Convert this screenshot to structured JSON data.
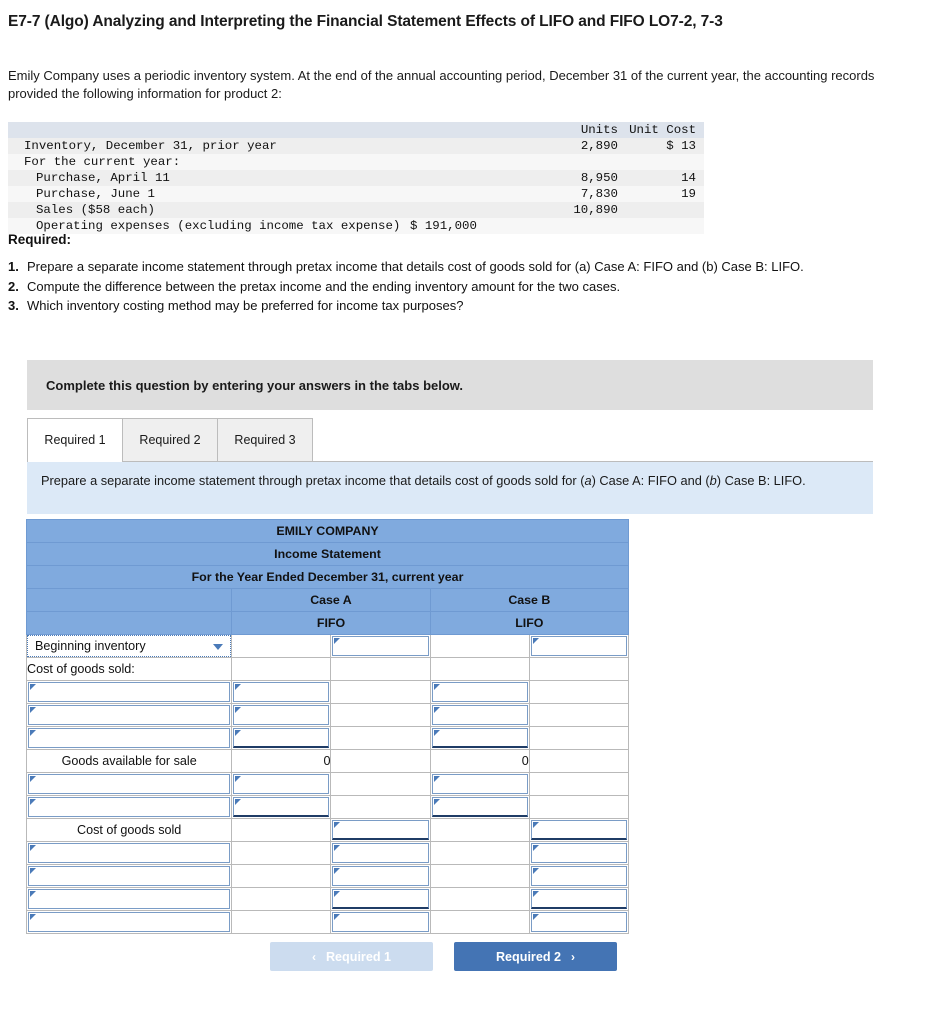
{
  "question": {
    "title": "E7-7 (Algo) Analyzing and Interpreting the Financial Statement Effects of LIFO and FIFO LO7-2, 7-3",
    "intro": "Emily Company uses a periodic inventory system. At the end of the annual accounting period, December 31 of the current year, the accounting records provided the following information for product 2:"
  },
  "data_table": {
    "headers": {
      "units": "Units",
      "unit_cost": "Unit Cost"
    },
    "rows": [
      {
        "label": "Inventory, December 31, prior year",
        "indent": 0,
        "op": "",
        "units": "2,890",
        "cost": "$ 13",
        "shade": "shade"
      },
      {
        "label": "For the current year:",
        "indent": 0,
        "op": "",
        "units": "",
        "cost": "",
        "shade": "plain"
      },
      {
        "label": "Purchase, April 11",
        "indent": 1,
        "op": "",
        "units": "8,950",
        "cost": "14",
        "shade": "shade"
      },
      {
        "label": "Purchase, June 1",
        "indent": 1,
        "op": "",
        "units": "7,830",
        "cost": "19",
        "shade": "plain"
      },
      {
        "label": "Sales ($58 each)",
        "indent": 1,
        "op": "",
        "units": "10,890",
        "cost": "",
        "shade": "shade"
      },
      {
        "label": "Operating expenses (excluding income tax expense)",
        "indent": 1,
        "op": "$ 191,000",
        "units": "",
        "cost": "",
        "shade": "plain"
      }
    ]
  },
  "required": {
    "heading": "Required:",
    "items": [
      {
        "num": "1.",
        "text": "Prepare a separate income statement through pretax income that details cost of goods sold for (a) Case A: FIFO and (b) Case B: LIFO."
      },
      {
        "num": "2.",
        "text": "Compute the difference between the pretax income and the ending inventory amount for the two cases."
      },
      {
        "num": "3.",
        "text": "Which inventory costing method may be preferred for income tax purposes?"
      }
    ]
  },
  "banner": {
    "text": "Complete this question by entering your answers in the tabs below."
  },
  "tabs": [
    {
      "label": "Required 1",
      "active": true
    },
    {
      "label": "Required 2",
      "active": false
    },
    {
      "label": "Required 3",
      "active": false
    }
  ],
  "tab_instruction": {
    "part1": "Prepare a separate income statement through pretax income that details cost of goods sold for (",
    "em1": "a",
    "part2": ") Case A: FIFO and (",
    "em2": "b",
    "part3": ") Case B: LIFO."
  },
  "worksheet": {
    "company": "EMILY COMPANY",
    "statement": "Income Statement",
    "period": "For the Year Ended December 31, current year",
    "case_a": "Case A",
    "case_b": "Case B",
    "method_a": "FIFO",
    "method_b": "LIFO",
    "rows": [
      {
        "type": "select",
        "label": "Beginning inventory",
        "a_in": "",
        "a_out": "input",
        "b_in": "",
        "b_out": "input"
      },
      {
        "type": "static",
        "label": "Cost of goods sold:",
        "align": "left",
        "a_in": "",
        "a_out": "",
        "b_in": "",
        "b_out": ""
      },
      {
        "type": "input",
        "label": "",
        "a_in": "input",
        "a_out": "",
        "b_in": "input",
        "b_out": ""
      },
      {
        "type": "input",
        "label": "",
        "a_in": "input",
        "a_out": "",
        "b_in": "input",
        "b_out": ""
      },
      {
        "type": "input",
        "label": "",
        "a_in": "input-tb",
        "a_out": "",
        "b_in": "input-tb",
        "b_out": ""
      },
      {
        "type": "total",
        "label": "Goods available for sale",
        "align": "center",
        "a_in": "0",
        "a_out": "",
        "b_in": "0",
        "b_out": ""
      },
      {
        "type": "input",
        "label": "",
        "a_in": "input",
        "a_out": "",
        "b_in": "input",
        "b_out": ""
      },
      {
        "type": "input",
        "label": "",
        "a_in": "input-tb",
        "a_out": "",
        "b_in": "input-tb",
        "b_out": ""
      },
      {
        "type": "total",
        "label": "Cost of goods sold",
        "align": "center",
        "a_in": "",
        "a_out": "input-tb",
        "b_in": "",
        "b_out": "input-tb"
      },
      {
        "type": "input",
        "label": "",
        "a_in": "",
        "a_out": "input",
        "b_in": "",
        "b_out": "input"
      },
      {
        "type": "input",
        "label": "",
        "a_in": "",
        "a_out": "input",
        "b_in": "",
        "b_out": "input"
      },
      {
        "type": "input",
        "label": "",
        "a_in": "",
        "a_out": "input-tb",
        "b_in": "",
        "b_out": "input-tb"
      },
      {
        "type": "input",
        "label": "",
        "a_in": "",
        "a_out": "input",
        "b_in": "",
        "b_out": "input"
      }
    ]
  },
  "nav": {
    "prev_label": "Required 1",
    "next_label": "Required 2",
    "prev_chevron": "‹",
    "next_chevron": "›"
  },
  "colors": {
    "header_blue": "#80aade",
    "instruction_blue": "#dce9f7",
    "banner_gray": "#dedede",
    "next_button": "#4474b4",
    "prev_button": "#ccdcef"
  }
}
